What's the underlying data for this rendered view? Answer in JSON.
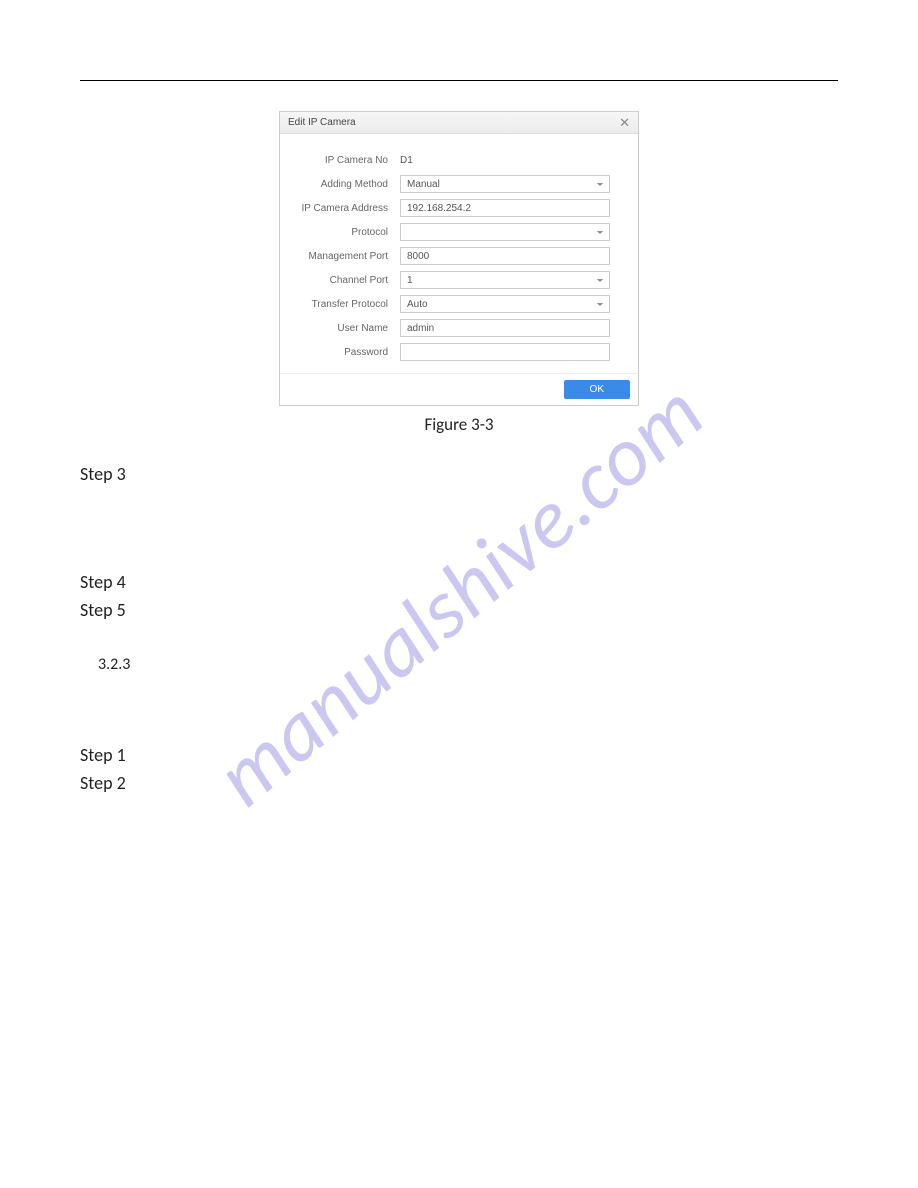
{
  "watermark": "manualshive.com",
  "dialog": {
    "title": "Edit IP Camera",
    "fields": {
      "camera_no_label": "IP Camera No",
      "camera_no_value": "D1",
      "adding_method_label": "Adding Method",
      "adding_method_value": "Manual",
      "address_label": "IP Camera Address",
      "address_value": "192.168.254.2",
      "protocol_label": "Protocol",
      "protocol_value": "",
      "mgmt_port_label": "Management Port",
      "mgmt_port_value": "8000",
      "channel_port_label": "Channel Port",
      "channel_port_value": "1",
      "transfer_proto_label": "Transfer Protocol",
      "transfer_proto_value": "Auto",
      "username_label": "User Name",
      "username_value": "admin",
      "password_label": "Password",
      "password_value": ""
    },
    "ok_label": "OK"
  },
  "caption": "Figure 3-3",
  "steps": {
    "s3": "Step 3",
    "s4": "Step 4",
    "s5": "Step 5",
    "s1b": "Step 1",
    "s2b": "Step 2"
  },
  "section": "3.2.3"
}
